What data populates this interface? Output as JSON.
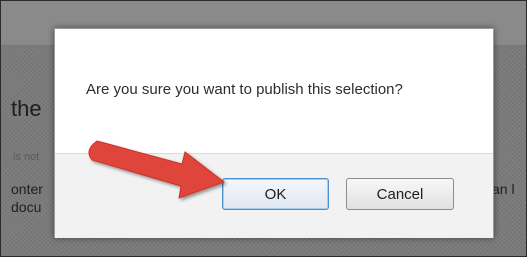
{
  "background": {
    "heading_fragment": "the",
    "small_fragment": "is not",
    "line1_fragment": "onter",
    "line2_fragment": "docu",
    "right_fragment": "can l"
  },
  "dialog": {
    "message": "Are you sure you want to publish this selection?",
    "ok_label": "OK",
    "cancel_label": "Cancel"
  },
  "annotation": {
    "arrow_color": "#e0443a"
  }
}
